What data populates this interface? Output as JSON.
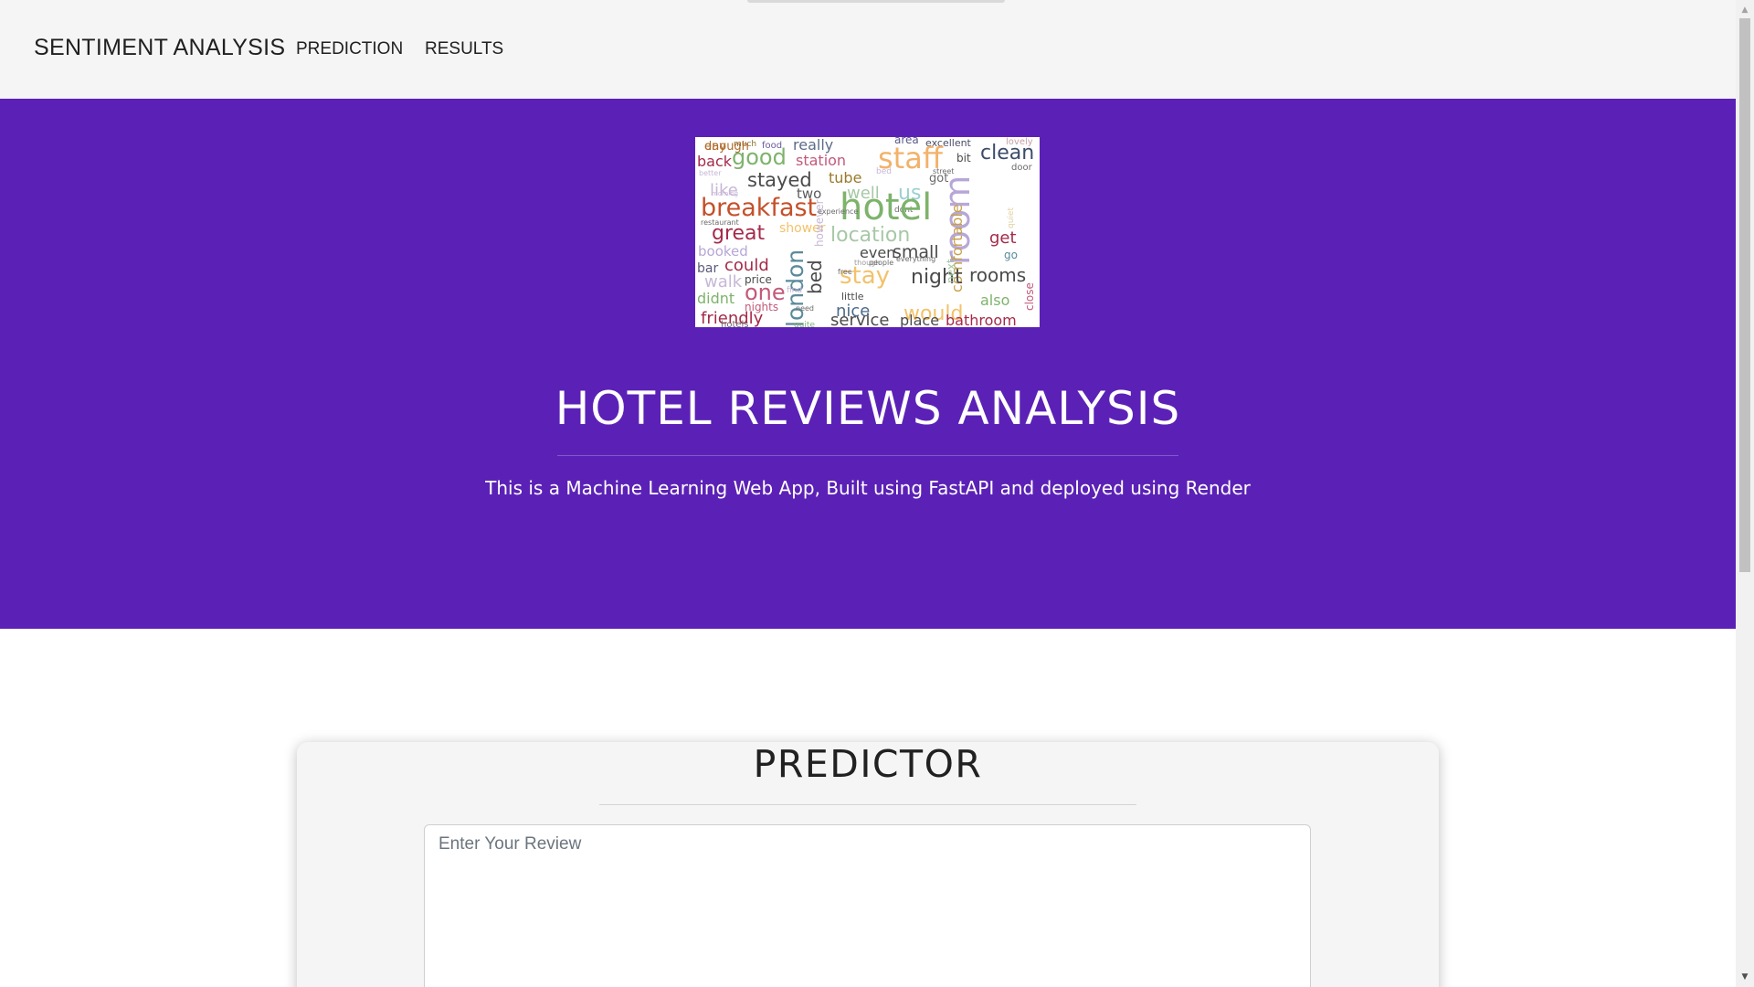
{
  "navbar": {
    "brand": "SENTIMENT ANALYSIS",
    "links": [
      {
        "label": "PREDICTION"
      },
      {
        "label": "RESULTS"
      }
    ]
  },
  "hero": {
    "image_alt": "hotel reviews word cloud",
    "title": "HOTEL REVIEWS ANALYSIS",
    "subtitle": "This is a Machine Learning Web App, Built using FastAPI and deployed using Render"
  },
  "predictor": {
    "title": "PREDICTOR",
    "review_value": "",
    "review_placeholder": "Enter Your Review"
  },
  "colors": {
    "navbar_bg": "#f5f5f5",
    "hero_bg": "#5b21b6",
    "card_bg": "#f5f5f5",
    "text_dark": "#212121"
  },
  "wordcloud_words": [
    "day",
    "much",
    "food",
    "really",
    "area",
    "excellent",
    "lovely",
    "back",
    "good",
    "station",
    "staff",
    "bit",
    "clean",
    "door",
    "stayed",
    "tube",
    "got",
    "like",
    "two",
    "well",
    "us",
    "dont",
    "breakfast",
    "hotel",
    "room",
    "comfortable",
    "great",
    "shower",
    "location",
    "get",
    "booked",
    "even",
    "small",
    "go",
    "bar",
    "could",
    "price",
    "stay",
    "night",
    "rooms",
    "walk",
    "one",
    "bed",
    "london",
    "next",
    "also",
    "didnt",
    "nights",
    "little",
    "nice",
    "would",
    "friendly",
    "service",
    "place",
    "bathroom",
    "close",
    "hotels",
    "quite",
    "restaurant",
    "morning",
    "better",
    "however",
    "experience",
    "free",
    "though",
    "people",
    "everything",
    "quiet",
    "need",
    "bed",
    "street",
    "find",
    "enough"
  ]
}
